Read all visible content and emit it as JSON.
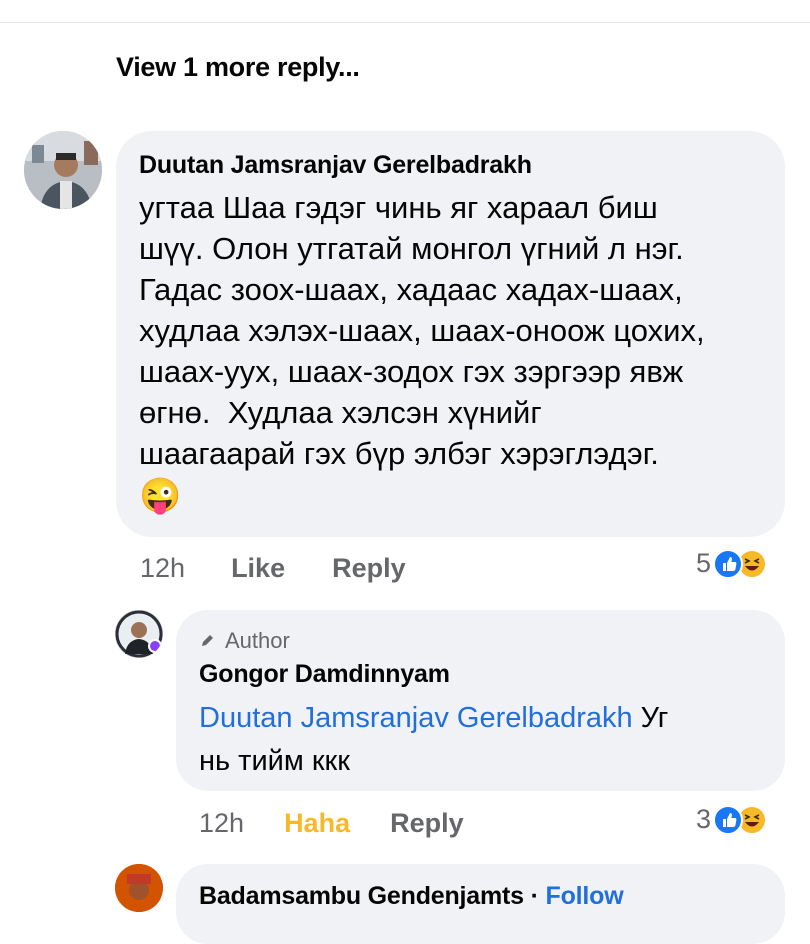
{
  "thread": {
    "view_more_label": "View 1 more reply..."
  },
  "comment1": {
    "author": "Duutan Jamsranjav Gerelbadrakh",
    "text_lines": [
      "угтаа Шаа гэдэг чинь яг хараал биш",
      "шүү. Олон утгатай монгол үгний л нэг.",
      "Гадас зоох-шаах, хадаас хадах-шаах,",
      "худлаа хэлэх-шаах, шаах-оноож цохих,",
      "шаах-уух, шаах-зодох гэх зэргээр явж",
      "өгнө.  Худлаа хэлсэн хүнийг",
      "шаагаарай гэх бүр элбэг хэрэглэдэг."
    ],
    "emoji": "😜",
    "time": "12h",
    "like_label": "Like",
    "reply_label": "Reply",
    "reaction_count": "5",
    "reaction_icons": [
      "like-icon",
      "haha-icon"
    ]
  },
  "comment2": {
    "author_badge": "Author",
    "author": "Gongor Damdinnyam",
    "mention": "Duutan Jamsranjav Gerelbadrakh",
    "text_after_mention": " Уг",
    "text_line2": "нь тийм ккк",
    "time": "12h",
    "reaction_label": "Haha",
    "reply_label": "Reply",
    "reaction_count": "3",
    "reaction_icons": [
      "like-icon",
      "haha-icon"
    ]
  },
  "comment3": {
    "author_partial": "Badamsambu Gendenjamts",
    "separator": " · ",
    "follow_label": "Follow"
  },
  "colors": {
    "link_blue": "#216fdb",
    "haha_yellow": "#f7b928",
    "bubble_bg": "#f0f2f5",
    "secondary_text": "#65676b"
  }
}
